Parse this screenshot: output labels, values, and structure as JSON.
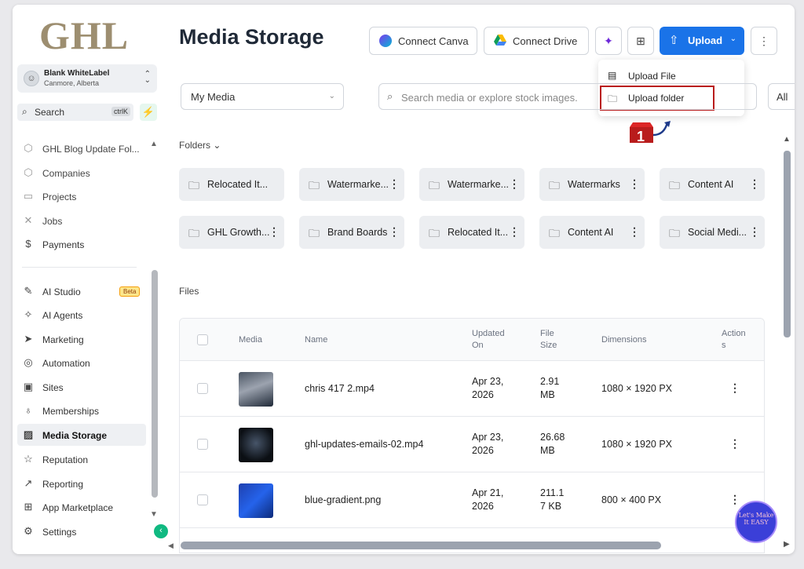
{
  "sidebar": {
    "logo": "GHL",
    "account": {
      "name": "Blank WhiteLabel",
      "location": "Canmore, Alberta"
    },
    "search": {
      "label": "Search",
      "shortcut": "ctrlK"
    },
    "items": [
      {
        "label": "GHL Blog Update Fol...",
        "icon": "cube-icon"
      },
      {
        "label": "Companies",
        "icon": "cube-icon"
      },
      {
        "label": "Projects",
        "icon": "projects-icon"
      },
      {
        "label": "Jobs",
        "icon": "jobs-icon"
      },
      {
        "label": "Payments",
        "icon": "payments-icon"
      },
      {
        "label": "AI Studio",
        "icon": "ai-studio-icon",
        "badge": "Beta"
      },
      {
        "label": "AI Agents",
        "icon": "sparkle-icon"
      },
      {
        "label": "Marketing",
        "icon": "send-icon"
      },
      {
        "label": "Automation",
        "icon": "automation-icon"
      },
      {
        "label": "Sites",
        "icon": "sites-icon"
      },
      {
        "label": "Memberships",
        "icon": "award-icon"
      },
      {
        "label": "Media Storage",
        "icon": "image-icon",
        "active": true
      },
      {
        "label": "Reputation",
        "icon": "star-icon"
      },
      {
        "label": "Reporting",
        "icon": "trend-icon"
      },
      {
        "label": "App Marketplace",
        "icon": "grid-icon"
      },
      {
        "label": "Settings",
        "icon": "gear-icon"
      }
    ]
  },
  "header": {
    "title": "Media Storage",
    "connect_canva": "Connect Canva",
    "connect_drive": "Connect Drive",
    "upload": "Upload"
  },
  "upload_menu": {
    "items": [
      "Upload File",
      "Upload folder"
    ],
    "annotation": "1"
  },
  "filters": {
    "source": "My Media",
    "search_placeholder": "Search media or explore stock images.",
    "type": "All"
  },
  "folders": {
    "heading": "Folders",
    "items": [
      "Relocated It...",
      "Watermarke...",
      "Watermarke...",
      "Watermarks",
      "Content AI",
      "GHL Growth...",
      "Brand Boards",
      "Relocated It...",
      "Content AI",
      "Social Medi..."
    ]
  },
  "files": {
    "heading": "Files",
    "columns": {
      "media": "Media",
      "name": "Name",
      "updated": "Updated On",
      "size": "File Size",
      "dimensions": "Dimensions",
      "actions": "Actions"
    },
    "rows": [
      {
        "name": "chris 417 2.mp4",
        "updated_1": "Apr 23,",
        "updated_2": "2026",
        "size_1": "2.91",
        "size_2": "MB",
        "dimensions": "1080 × 1920 PX"
      },
      {
        "name": "ghl-updates-emails-02.mp4",
        "updated_1": "Apr 23,",
        "updated_2": "2026",
        "size_1": "26.68",
        "size_2": "MB",
        "dimensions": "1080 × 1920 PX"
      },
      {
        "name": "blue-gradient.png",
        "updated_1": "Apr 21,",
        "updated_2": "2026",
        "size_1": "211.1",
        "size_2": "7 KB",
        "dimensions": "800 × 400 PX"
      }
    ]
  },
  "watermark": "Let's Make It EASY",
  "colors": {
    "primary": "#1a73e8",
    "accent_green": "#10b981",
    "annotation_red": "#b91c1c"
  }
}
